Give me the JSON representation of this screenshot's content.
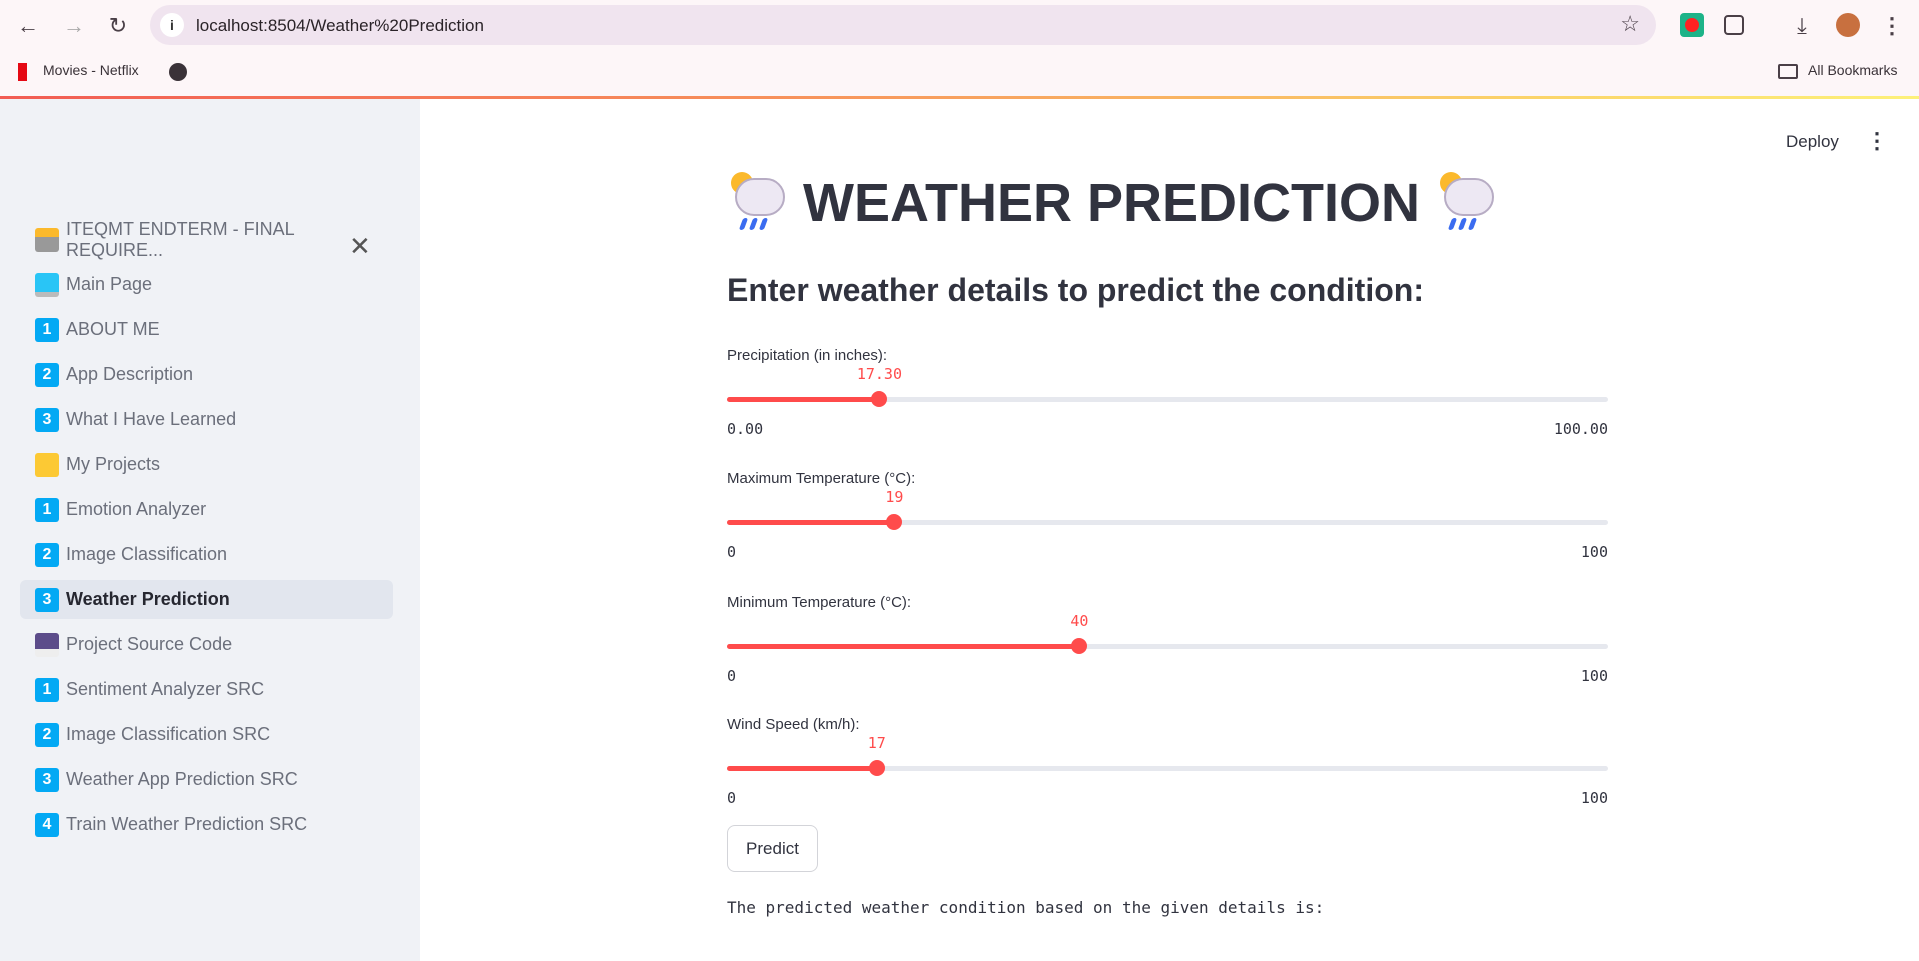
{
  "browser": {
    "url": "localhost:8504/Weather%20Prediction",
    "bookmarks": [
      {
        "label": "Movies - Netflix"
      }
    ],
    "all_bookmarks": "All Bookmarks"
  },
  "header": {
    "deploy_label": "Deploy"
  },
  "sidebar": {
    "items": [
      {
        "label": "ITEQMT ENDTERM - FINAL REQUIRE...",
        "icon": "technologist-icon"
      },
      {
        "label": "Main Page",
        "icon": "laptop-icon"
      },
      {
        "label": "ABOUT ME",
        "icon": "keycap-1-icon",
        "badge": "1"
      },
      {
        "label": "App Description",
        "icon": "keycap-2-icon",
        "badge": "2"
      },
      {
        "label": "What I Have Learned",
        "icon": "keycap-3-icon",
        "badge": "3"
      },
      {
        "label": "My Projects",
        "icon": "folder-icon"
      },
      {
        "label": "Emotion Analyzer",
        "icon": "keycap-1-icon",
        "badge": "1"
      },
      {
        "label": "Image Classification",
        "icon": "keycap-2-icon",
        "badge": "2"
      },
      {
        "label": "Weather Prediction",
        "icon": "keycap-3-icon",
        "badge": "3",
        "active": true
      },
      {
        "label": "Project Source Code",
        "icon": "floppy-disk-icon"
      },
      {
        "label": "Sentiment Analyzer SRC",
        "icon": "keycap-1-icon",
        "badge": "1"
      },
      {
        "label": "Image Classification SRC",
        "icon": "keycap-2-icon",
        "badge": "2"
      },
      {
        "label": "Weather App Prediction SRC",
        "icon": "keycap-3-icon",
        "badge": "3"
      },
      {
        "label": "Train Weather Prediction SRC",
        "icon": "keycap-4-icon",
        "badge": "4"
      }
    ]
  },
  "main": {
    "title": "WEATHER PREDICTION",
    "subtitle": "Enter weather details to predict the condition:",
    "sliders": [
      {
        "label": "Precipitation (in inches):",
        "value": 17.3,
        "display": "17.30",
        "min": "0.00",
        "max": "100.00",
        "min_v": 0,
        "max_v": 100
      },
      {
        "label": "Maximum Temperature (°C):",
        "value": 19,
        "display": "19",
        "min": "0",
        "max": "100",
        "min_v": 0,
        "max_v": 100
      },
      {
        "label": "Minimum Temperature (°C):",
        "value": 40,
        "display": "40",
        "min": "0",
        "max": "100",
        "min_v": 0,
        "max_v": 100
      },
      {
        "label": "Wind Speed (km/h):",
        "value": 17,
        "display": "17",
        "min": "0",
        "max": "100",
        "min_v": 0,
        "max_v": 100
      }
    ],
    "predict_label": "Predict",
    "result_text": "The predicted weather condition based on the given details is:"
  },
  "colors": {
    "accent": "#ff4b4b",
    "badge": "#03a9f4"
  }
}
